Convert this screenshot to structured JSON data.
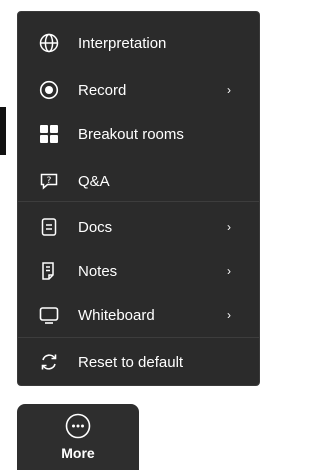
{
  "menu": {
    "items": [
      {
        "label": "Interpretation",
        "icon": "globe-icon",
        "has_submenu": false
      },
      {
        "label": "Record",
        "icon": "record-icon",
        "has_submenu": true
      },
      {
        "label": "Breakout rooms",
        "icon": "breakout-rooms-icon",
        "has_submenu": false
      },
      {
        "label": "Q&A",
        "icon": "qa-icon",
        "has_submenu": false
      },
      {
        "label": "Docs",
        "icon": "docs-icon",
        "has_submenu": true
      },
      {
        "label": "Notes",
        "icon": "notes-icon",
        "has_submenu": true
      },
      {
        "label": "Whiteboard",
        "icon": "whiteboard-icon",
        "has_submenu": true
      },
      {
        "label": "Reset to default",
        "icon": "reset-icon",
        "has_submenu": false
      }
    ],
    "chevron": "›"
  },
  "more_button": {
    "label": "More",
    "icon": "more-icon"
  },
  "colors": {
    "menu_bg": "#2b2b2b",
    "dock_bg": "#2e2e2e",
    "text": "#ffffff"
  }
}
